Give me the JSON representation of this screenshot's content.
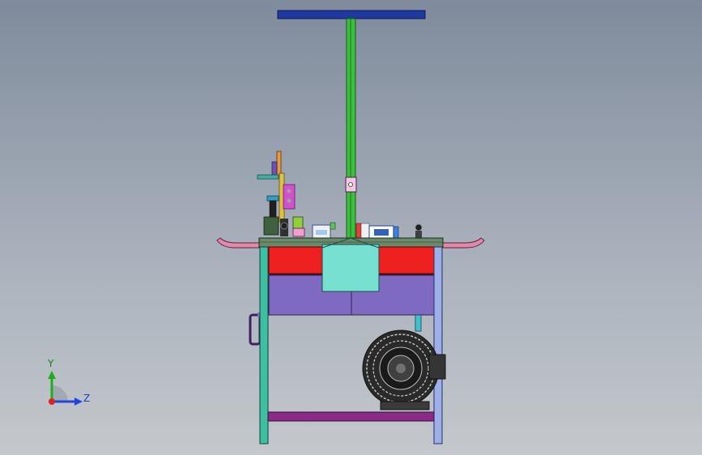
{
  "viewport": {
    "background_top": "#7f8b9c",
    "background_bottom": "#c4c8cc"
  },
  "triad": {
    "y_label": "Y",
    "z_label": "Z",
    "y_color": "#22aa22",
    "z_color": "#2244dd",
    "x_color": "#dd2222"
  },
  "colors": {
    "pole_top": "#1e3aa0",
    "pole": "#3cbf3c",
    "table_top": "#6a8a6a",
    "drawer_red": "#ee2020",
    "drawer_purple": "#7e6ac0",
    "center_box": "#78e0d0",
    "leg_left": "#3cc0a0",
    "leg_right": "#9fb0e8",
    "bottom_bar": "#8a2a8a",
    "pipe": "#e08aa8",
    "blower": "#333333"
  }
}
